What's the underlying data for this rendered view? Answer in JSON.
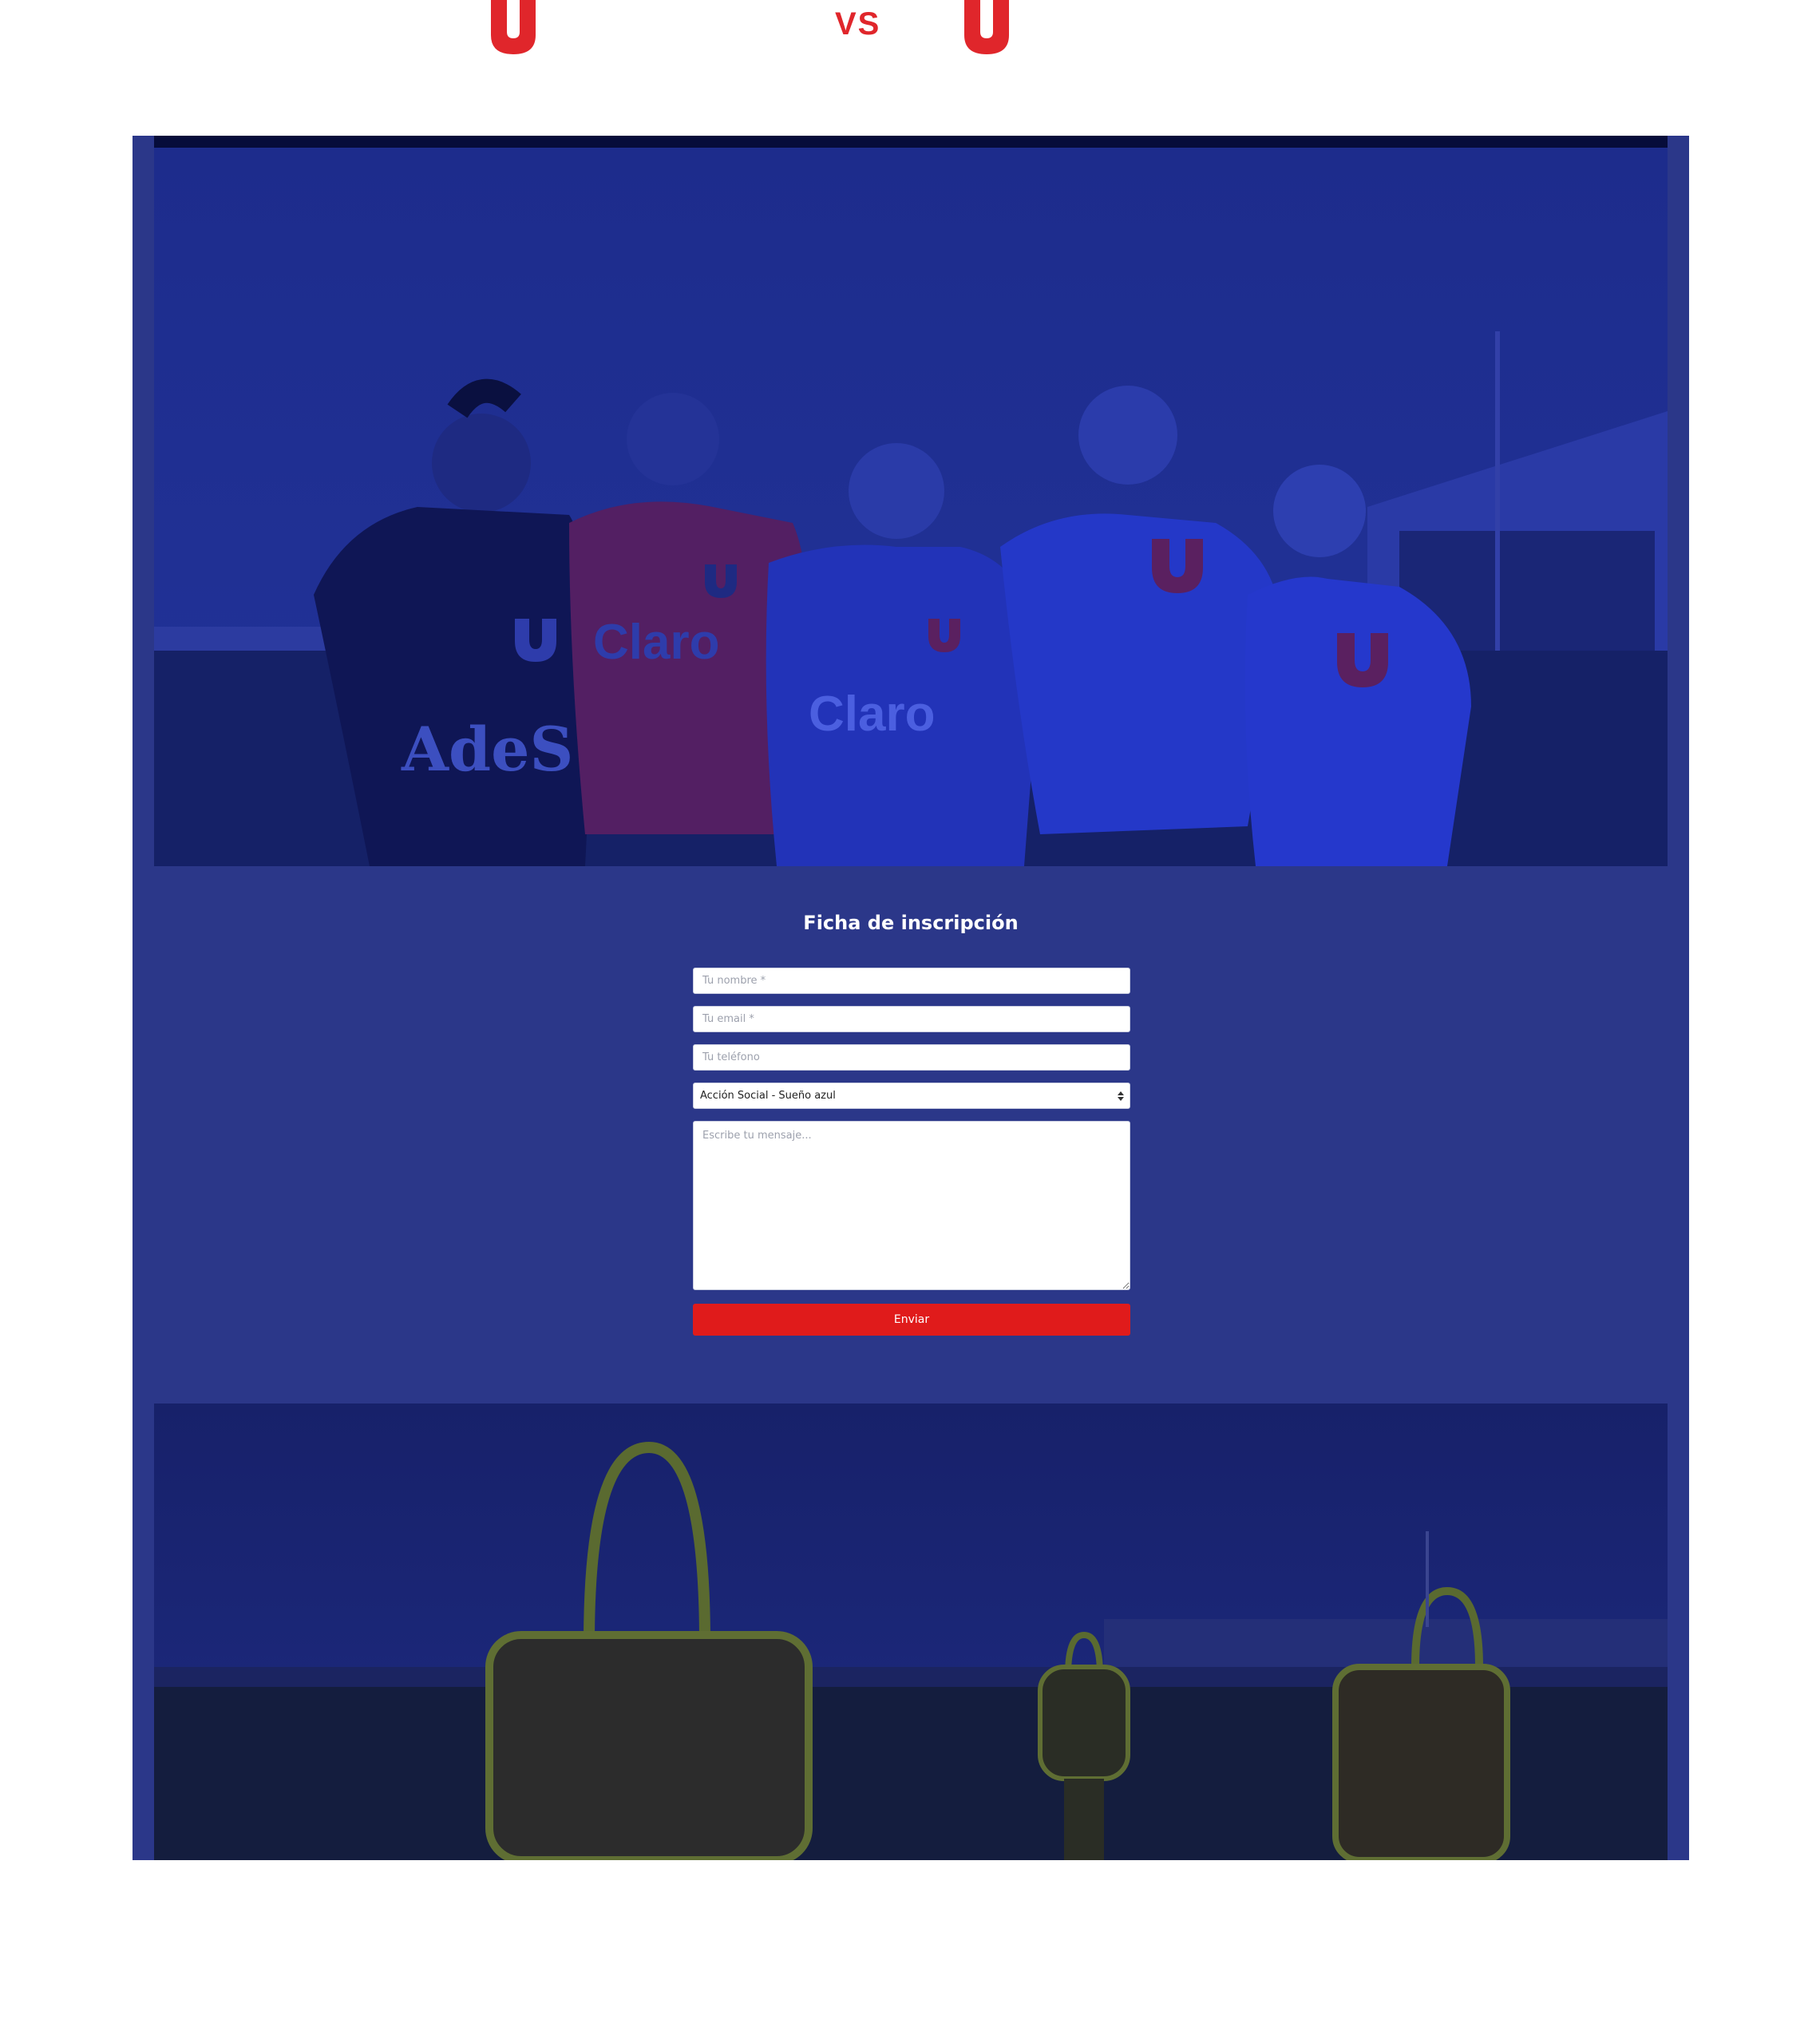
{
  "match": {
    "vs_label": "VS",
    "team_left_logo": "u-crest-icon",
    "team_right_logo": "u-crest-icon",
    "accent_color": "#e0262b"
  },
  "photos": {
    "top": {
      "subject": "five-players-in-team-jerseys",
      "jersey_texts": [
        "AdeS",
        "Claro",
        "Claro"
      ]
    },
    "bottom": {
      "subject": "training-dummies-on-field"
    }
  },
  "form": {
    "title": "Ficha de inscripción",
    "name_placeholder": "Tu nombre *",
    "email_placeholder": "Tu email *",
    "phone_placeholder": "Tu teléfono",
    "subject_selected": "Acción Social - Sueño azul",
    "message_placeholder": "Escribe tu mensaje...",
    "submit_label": "Enviar"
  },
  "colors": {
    "frame_blue": "#2b3789",
    "dark_bar": "#060c3a",
    "button_red": "#e01b1b",
    "white": "#ffffff"
  }
}
